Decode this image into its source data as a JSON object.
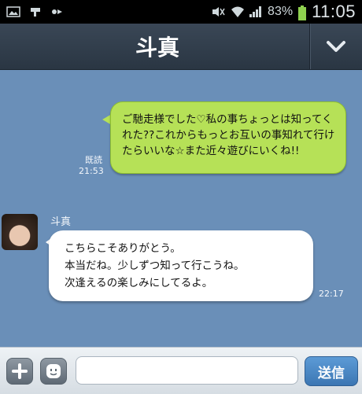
{
  "status_bar": {
    "battery_percent": "83%",
    "time": "11:05",
    "icons": [
      "image-icon",
      "signal-app-icon",
      "data-icon",
      "mute-icon",
      "wifi-icon",
      "signal-bars-icon",
      "battery-icon"
    ]
  },
  "header": {
    "title": "斗真",
    "menu_icon": "chevron-down-icon"
  },
  "messages": {
    "outgoing": {
      "text": "ご馳走様でした♡私の事ちょっとは知ってくれた??これからもっとお互いの事知れて行けたらいいな☆また近々遊びにいくね!!",
      "read_label": "既読",
      "time": "21:53"
    },
    "incoming": {
      "sender": "斗真",
      "lines": [
        "こちらこそありがとう。",
        "本当だね。少しずつ知って行こうね。",
        "次逢えるの楽しみにしてるよ。"
      ],
      "time": "22:17"
    }
  },
  "input_bar": {
    "plus_icon": "plus-icon",
    "emoji_icon": "emoji-icon",
    "input_value": "",
    "send_label": "送信"
  },
  "colors": {
    "chat_background": "#6a8fb8",
    "outgoing_bubble": "#b6e157",
    "incoming_bubble": "#ffffff",
    "header": "#2f3b48",
    "send_button": "#4a86c5"
  }
}
